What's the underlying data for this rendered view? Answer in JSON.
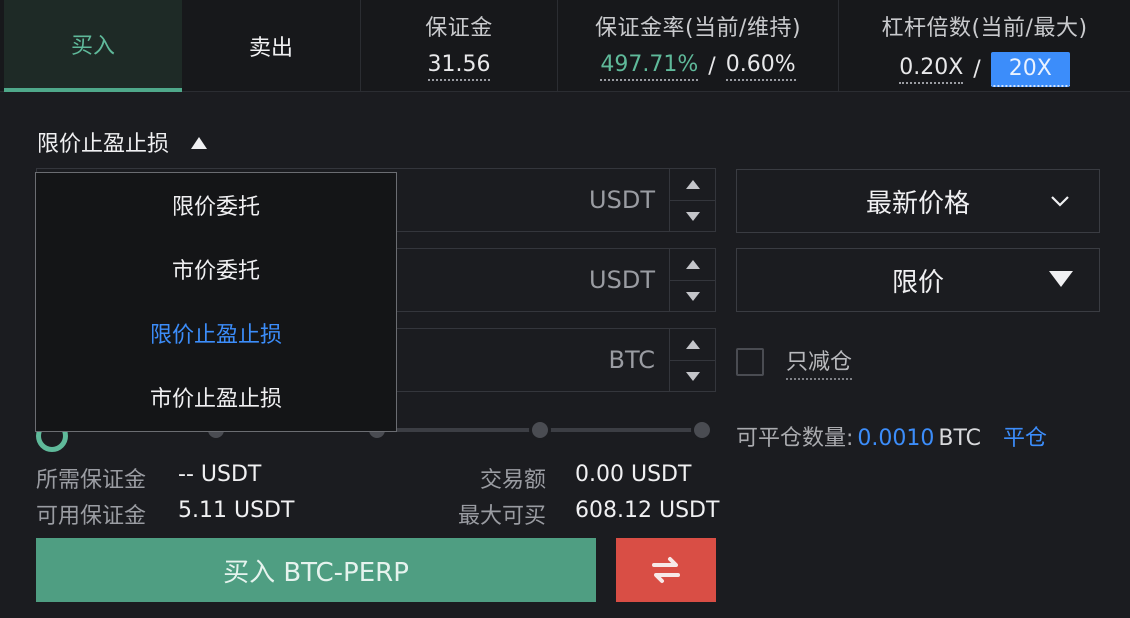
{
  "tabs": {
    "buy": "买入",
    "sell": "卖出"
  },
  "stats": {
    "margin": {
      "label": "保证金",
      "value": "31.56"
    },
    "margin_ratio": {
      "label": "保证金率(当前/维持)",
      "current": "497.71%",
      "separator": "/",
      "maintenance": "0.60%"
    },
    "leverage": {
      "label": "杠杆倍数(当前/最大)",
      "current": "0.20X",
      "separator": "/",
      "max": "20X"
    }
  },
  "order_type": {
    "selected": "限价止盈止损"
  },
  "menu": {
    "items": [
      "限价委托",
      "市价委托",
      "限价止盈止损",
      "市价止盈止损"
    ],
    "active_index": 2
  },
  "fields": [
    {
      "unit": "USDT",
      "value": ""
    },
    {
      "unit": "USDT",
      "value": ""
    },
    {
      "unit": "BTC",
      "value": ""
    }
  ],
  "trigger_price_select": {
    "value": "最新价格"
  },
  "exec_type_select": {
    "value": "限价"
  },
  "reduce_only": {
    "label": "只减仓",
    "checked": false
  },
  "closable": {
    "label": "可平仓数量:",
    "value": "0.0010",
    "unit": "BTC",
    "action": "平仓"
  },
  "slider": {
    "percent": 0,
    "marks": [
      0,
      25,
      50,
      75,
      100
    ]
  },
  "info": {
    "required_margin": {
      "label": "所需保证金",
      "value": "-- USDT"
    },
    "available_margin": {
      "label": "可用保证金",
      "value": "5.11 USDT"
    },
    "trade_amount": {
      "label": "交易额",
      "value": "0.00 USDT"
    },
    "max_buy": {
      "label": "最大可买",
      "value": "608.12 USDT"
    }
  },
  "buy_button": {
    "label": "买入 BTC-PERP"
  },
  "icons": {
    "swap": "swap-arrows-icon",
    "chevron": "chevron-down-icon"
  },
  "colors": {
    "buy": "#4f9e82",
    "sell": "#d94e45",
    "accent": "#3c8dfa",
    "positive": "#5fb99a"
  }
}
